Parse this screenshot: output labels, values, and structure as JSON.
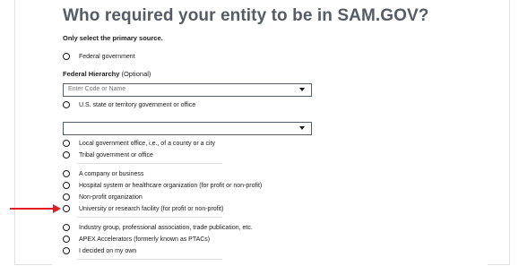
{
  "form": {
    "title": "Who required your entity to be in SAM.GOV?",
    "instruction": "Only select the primary source.",
    "options": {
      "federal": "Federal government",
      "state": "U.S. state or territory government or office",
      "local": "Local government office, i.e., of a county or a city",
      "tribal": "Tribal government or office",
      "business": "A company or business",
      "hospital": "Hospital system or healthcare organization (for profit or non-profit)",
      "nonprofit": "Non-profit organization",
      "university": "University or research facility (for profit or non-profit)",
      "industry": "Industry group, professional association, trade publication, etc.",
      "apex": "APEX Accelerators (formerly known as PTACs)",
      "own": "I decided on my own"
    },
    "federal_hierarchy": {
      "label": "Federal Hierarchy",
      "optional": "(Optional)",
      "placeholder": "Enter Code or Name"
    },
    "state_select": {
      "value": ""
    }
  },
  "annotation": {
    "arrow_color": "#e31b23",
    "points_to": "university"
  }
}
